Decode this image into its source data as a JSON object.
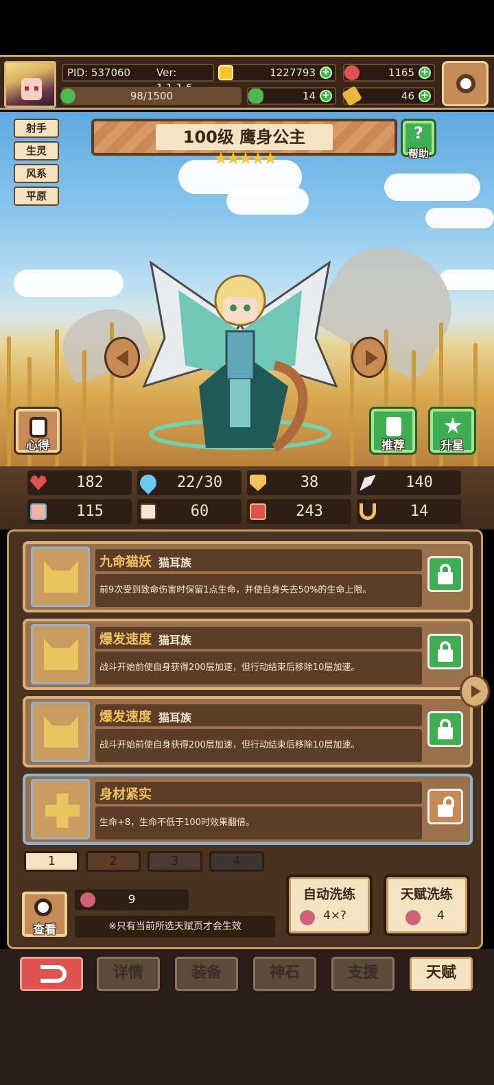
{
  "header": {
    "pid": "PID: 537060",
    "version": "Ver: 1.1.1.6",
    "gold": "1227793",
    "gems": "1165",
    "energy": "98/1500",
    "clover": "14",
    "key": "46"
  },
  "hero": {
    "title": "100级 鹰身公主",
    "stars": 5,
    "help_label": "帮助",
    "tags": [
      "射手",
      "生灵",
      "风系",
      "平原"
    ],
    "left_button": "心得",
    "recommend_button": "推荐",
    "upstar_button": "升星"
  },
  "stats": [
    {
      "icon": "heart-icon",
      "value": "182"
    },
    {
      "icon": "water-drop-icon",
      "value": "22/30"
    },
    {
      "icon": "shield-icon",
      "value": "38"
    },
    {
      "icon": "wing-icon",
      "value": "140"
    },
    {
      "icon": "fist-icon",
      "value": "115"
    },
    {
      "icon": "book-icon",
      "value": "60"
    },
    {
      "icon": "potion-icon",
      "value": "243"
    },
    {
      "icon": "horseshoe-icon",
      "value": "14"
    }
  ],
  "talents": [
    {
      "name": "九命猫妖",
      "race": "猫耳族",
      "desc": "前9次受到致命伤害时保留1点生命，并使自身失去50%的生命上限。"
    },
    {
      "name": "爆发速度",
      "race": "猫耳族",
      "desc": "战斗开始前使自身获得200层加速，但行动结束后移除10层加速。"
    },
    {
      "name": "爆发速度",
      "race": "猫耳族",
      "desc": "战斗开始前使自身获得200层加速，但行动结束后移除10层加速。"
    },
    {
      "name": "身材紧实",
      "race": "",
      "desc": "生命+8，生命不低于100时效果翻倍。"
    }
  ],
  "pages": [
    "1",
    "2",
    "3",
    "4"
  ],
  "bottom": {
    "view_label": "查看",
    "fruit_count": "9",
    "note": "※只有当前所选天赋页才会生效",
    "auto_reroll_label": "自动洗练",
    "auto_reroll_cost": "4×?",
    "reroll_label": "天赋洗练",
    "reroll_cost": "4"
  },
  "nav": [
    "详情",
    "装备",
    "神石",
    "支援",
    "天赋"
  ],
  "colors": {
    "accent_gold": "#f2c25a",
    "panel_brown": "#4a3221",
    "lock_green": "#3fae52",
    "back_red": "#e0524f",
    "active_tab": "#f4e3c0"
  }
}
